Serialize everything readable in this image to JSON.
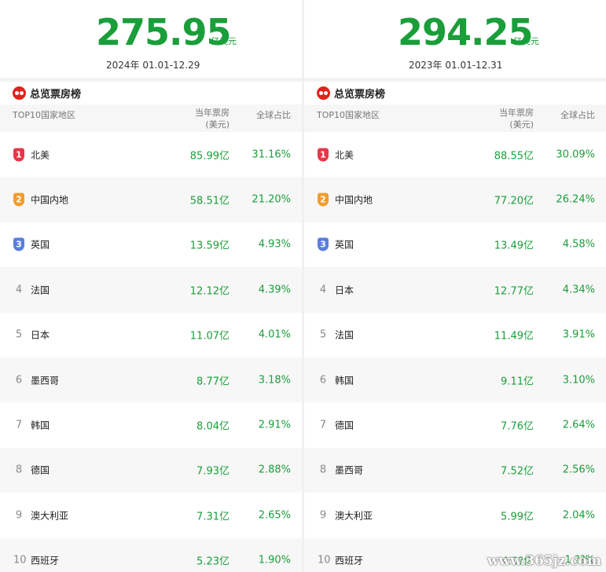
{
  "colors": {
    "accent_red": "#e2231a",
    "value_green": "#1a9e3a",
    "medal_1": "#e8364a",
    "medal_2": "#f39c2d",
    "medal_3": "#5a7ede"
  },
  "left": {
    "total": "275.95",
    "unit": "亿美元",
    "date": "2024年  01.01-12.29",
    "section_title": "总览票房榜",
    "logo_icon": "maoyan-logo-icon",
    "headers": {
      "region": "TOP10国家地区",
      "box_line1": "当年票房",
      "box_line2": "(美元)",
      "share": "全球占比"
    },
    "rows": [
      {
        "rank": "1",
        "name": "北美",
        "box": "85.99亿",
        "share": "31.16%"
      },
      {
        "rank": "2",
        "name": "中国内地",
        "box": "58.51亿",
        "share": "21.20%"
      },
      {
        "rank": "3",
        "name": "英国",
        "box": "13.59亿",
        "share": "4.93%"
      },
      {
        "rank": "4",
        "name": "法国",
        "box": "12.12亿",
        "share": "4.39%"
      },
      {
        "rank": "5",
        "name": "日本",
        "box": "11.07亿",
        "share": "4.01%"
      },
      {
        "rank": "6",
        "name": "墨西哥",
        "box": "8.77亿",
        "share": "3.18%"
      },
      {
        "rank": "7",
        "name": "韩国",
        "box": "8.04亿",
        "share": "2.91%"
      },
      {
        "rank": "8",
        "name": "德国",
        "box": "7.93亿",
        "share": "2.88%"
      },
      {
        "rank": "9",
        "name": "澳大利亚",
        "box": "7.31亿",
        "share": "2.65%"
      },
      {
        "rank": "10",
        "name": "西班牙",
        "box": "5.23亿",
        "share": "1.90%"
      }
    ]
  },
  "right": {
    "total": "294.25",
    "unit": "亿美元",
    "date": "2023年  01.01-12.31",
    "section_title": "总览票房榜",
    "logo_icon": "maoyan-logo-icon",
    "headers": {
      "region": "TOP10国家地区",
      "box_line1": "当年票房",
      "box_line2": "(美元)",
      "share": "全球占比"
    },
    "rows": [
      {
        "rank": "1",
        "name": "北美",
        "box": "88.55亿",
        "share": "30.09%"
      },
      {
        "rank": "2",
        "name": "中国内地",
        "box": "77.20亿",
        "share": "26.24%"
      },
      {
        "rank": "3",
        "name": "英国",
        "box": "13.49亿",
        "share": "4.58%"
      },
      {
        "rank": "4",
        "name": "日本",
        "box": "12.77亿",
        "share": "4.34%"
      },
      {
        "rank": "5",
        "name": "法国",
        "box": "11.49亿",
        "share": "3.91%"
      },
      {
        "rank": "6",
        "name": "韩国",
        "box": "9.11亿",
        "share": "3.10%"
      },
      {
        "rank": "7",
        "name": "德国",
        "box": "7.76亿",
        "share": "2.64%"
      },
      {
        "rank": "8",
        "name": "墨西哥",
        "box": "7.52亿",
        "share": "2.56%"
      },
      {
        "rank": "9",
        "name": "澳大利亚",
        "box": "5.99亿",
        "share": "2.04%"
      },
      {
        "rank": "10",
        "name": "西班牙",
        "box": "4.0?亿",
        "share": "1.??%"
      }
    ]
  },
  "watermark": "www.365jz.com"
}
